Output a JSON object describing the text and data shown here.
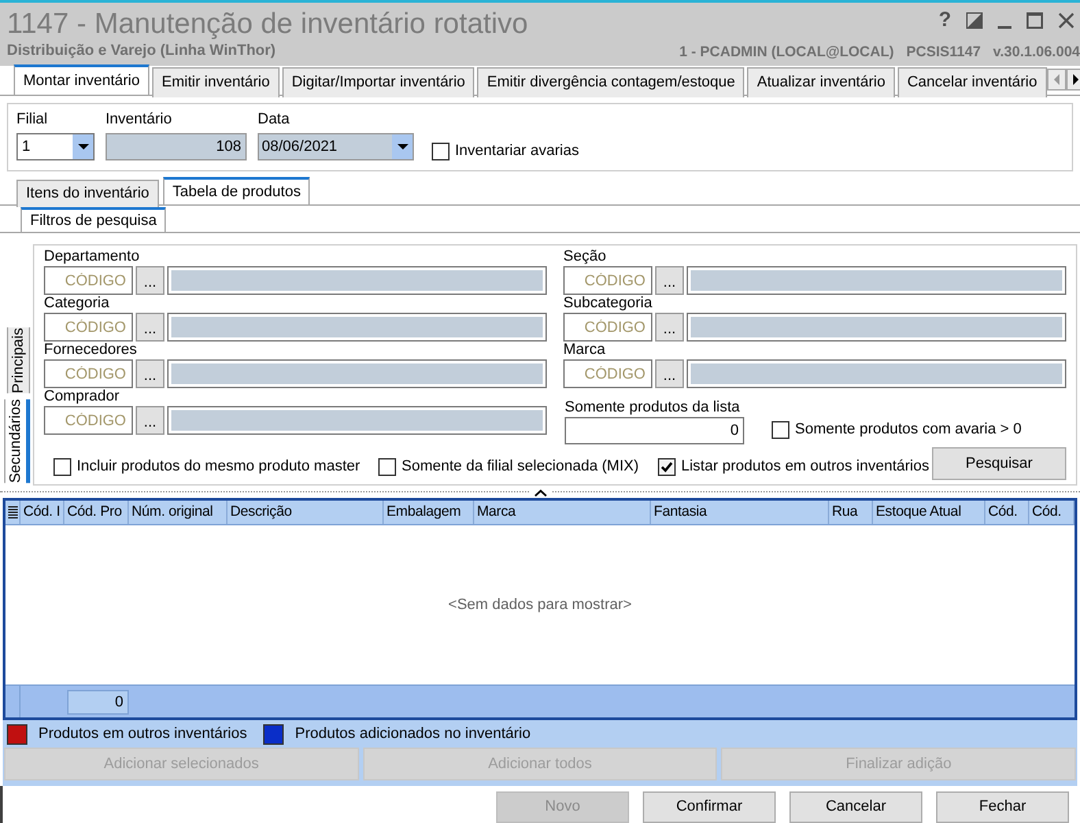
{
  "window": {
    "title": "1147 - Manutenção de inventário rotativo",
    "subtitle": "Distribuição e Varejo (Linha WinThor)",
    "help": "?",
    "user": "1 - PCADMIN (LOCAL@LOCAL)",
    "program": "PCSIS1147",
    "version": "v.30.1.06.004"
  },
  "main_tabs": [
    {
      "label": "Montar inventário",
      "selected": true
    },
    {
      "label": "Emitir inventário",
      "selected": false
    },
    {
      "label": "Digitar/Importar inventário",
      "selected": false
    },
    {
      "label": "Emitir divergência contagem/estoque",
      "selected": false
    },
    {
      "label": "Atualizar inventário",
      "selected": false
    },
    {
      "label": "Cancelar inventário",
      "selected": false
    }
  ],
  "header_form": {
    "filial": {
      "label": "Filial",
      "value": "1"
    },
    "inventario": {
      "label": "Inventário",
      "value": "108"
    },
    "data": {
      "label": "Data",
      "value": "08/06/2021"
    },
    "inventariar_avarias": {
      "label": "Inventariar avarias",
      "checked": false
    }
  },
  "sub_tabs": [
    {
      "label": "Itens do inventário",
      "selected": false
    },
    {
      "label": "Tabela de produtos",
      "selected": true
    }
  ],
  "filter_tabs": [
    {
      "label": "Filtros de pesquisa",
      "selected": true
    }
  ],
  "side_tabs": [
    {
      "label": "Principais",
      "selected": false
    },
    {
      "label": "Secundários",
      "selected": true
    }
  ],
  "filters": {
    "left": [
      {
        "label": "Departamento",
        "placeholder": "CÓDIGO",
        "button": "..."
      },
      {
        "label": "Categoria",
        "placeholder": "CÓDIGO",
        "button": "..."
      },
      {
        "label": "Fornecedores",
        "placeholder": "CÓDIGO",
        "button": "..."
      },
      {
        "label": "Comprador",
        "placeholder": "CÓDIGO",
        "button": "..."
      }
    ],
    "right": [
      {
        "label": "Seção",
        "placeholder": "CÓDIGO",
        "button": "..."
      },
      {
        "label": "Subcategoria",
        "placeholder": "CÓDIGO",
        "button": "..."
      },
      {
        "label": "Marca",
        "placeholder": "CÓDIGO",
        "button": "..."
      }
    ],
    "lista": {
      "label": "Somente produtos da lista",
      "value": "0"
    },
    "avaria": {
      "label": "Somente produtos com avaria > 0",
      "checked": false
    },
    "options": [
      {
        "label": "Incluir produtos do mesmo produto master",
        "checked": false
      },
      {
        "label": "Somente da filial selecionada (MIX)",
        "checked": false
      },
      {
        "label": "Listar produtos em outros inventários",
        "checked": true
      }
    ],
    "search_button": "Pesquisar"
  },
  "grid": {
    "columns": [
      "Cód. I",
      "Cód. Pro",
      "Núm. original",
      "Descrição",
      "Embalagem",
      "Marca",
      "Fantasia",
      "Rua",
      "Estoque Atual",
      "Cód.",
      "Cód."
    ],
    "empty_message": "<Sem dados para mostrar>",
    "footer_value": "0"
  },
  "legend": [
    {
      "label": "Produtos em outros inventários",
      "color": "#c01010"
    },
    {
      "label": "Produtos adicionados no inventário",
      "color": "#0a2ec8"
    }
  ],
  "action_buttons": [
    {
      "label": "Adicionar selecionados",
      "disabled": true
    },
    {
      "label": "Adicionar todos",
      "disabled": true
    },
    {
      "label": "Finalizar adição",
      "disabled": true
    }
  ],
  "buttons": [
    {
      "label": "Novo",
      "disabled": true
    },
    {
      "label": "Confirmar",
      "disabled": false
    },
    {
      "label": "Cancelar",
      "disabled": false
    },
    {
      "label": "Fechar",
      "disabled": false
    }
  ]
}
